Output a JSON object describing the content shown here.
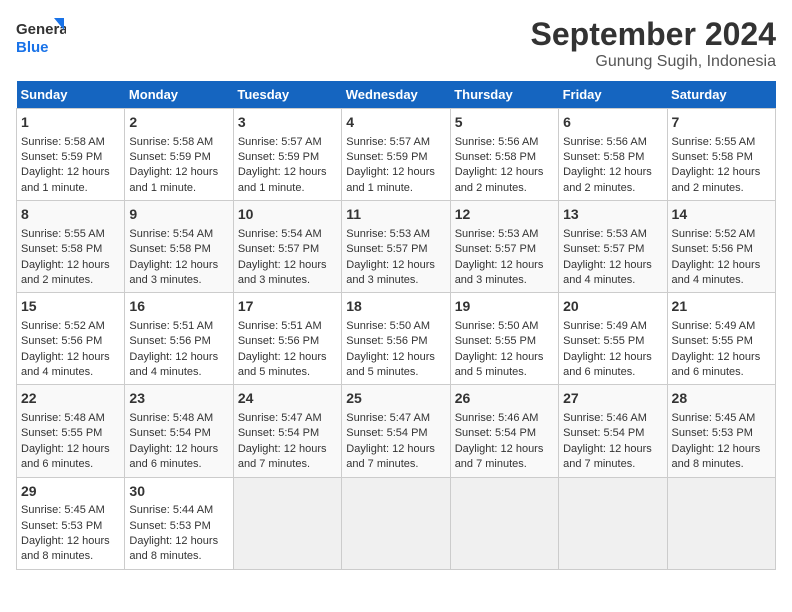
{
  "header": {
    "logo_line1": "General",
    "logo_line2": "Blue",
    "title": "September 2024",
    "subtitle": "Gunung Sugih, Indonesia"
  },
  "days_of_week": [
    "Sunday",
    "Monday",
    "Tuesday",
    "Wednesday",
    "Thursday",
    "Friday",
    "Saturday"
  ],
  "weeks": [
    [
      {
        "day": "1",
        "info": "Sunrise: 5:58 AM\nSunset: 5:59 PM\nDaylight: 12 hours and 1 minute."
      },
      {
        "day": "2",
        "info": "Sunrise: 5:58 AM\nSunset: 5:59 PM\nDaylight: 12 hours and 1 minute."
      },
      {
        "day": "3",
        "info": "Sunrise: 5:57 AM\nSunset: 5:59 PM\nDaylight: 12 hours and 1 minute."
      },
      {
        "day": "4",
        "info": "Sunrise: 5:57 AM\nSunset: 5:59 PM\nDaylight: 12 hours and 1 minute."
      },
      {
        "day": "5",
        "info": "Sunrise: 5:56 AM\nSunset: 5:58 PM\nDaylight: 12 hours and 2 minutes."
      },
      {
        "day": "6",
        "info": "Sunrise: 5:56 AM\nSunset: 5:58 PM\nDaylight: 12 hours and 2 minutes."
      },
      {
        "day": "7",
        "info": "Sunrise: 5:55 AM\nSunset: 5:58 PM\nDaylight: 12 hours and 2 minutes."
      }
    ],
    [
      {
        "day": "8",
        "info": "Sunrise: 5:55 AM\nSunset: 5:58 PM\nDaylight: 12 hours and 2 minutes."
      },
      {
        "day": "9",
        "info": "Sunrise: 5:54 AM\nSunset: 5:58 PM\nDaylight: 12 hours and 3 minutes."
      },
      {
        "day": "10",
        "info": "Sunrise: 5:54 AM\nSunset: 5:57 PM\nDaylight: 12 hours and 3 minutes."
      },
      {
        "day": "11",
        "info": "Sunrise: 5:53 AM\nSunset: 5:57 PM\nDaylight: 12 hours and 3 minutes."
      },
      {
        "day": "12",
        "info": "Sunrise: 5:53 AM\nSunset: 5:57 PM\nDaylight: 12 hours and 3 minutes."
      },
      {
        "day": "13",
        "info": "Sunrise: 5:53 AM\nSunset: 5:57 PM\nDaylight: 12 hours and 4 minutes."
      },
      {
        "day": "14",
        "info": "Sunrise: 5:52 AM\nSunset: 5:56 PM\nDaylight: 12 hours and 4 minutes."
      }
    ],
    [
      {
        "day": "15",
        "info": "Sunrise: 5:52 AM\nSunset: 5:56 PM\nDaylight: 12 hours and 4 minutes."
      },
      {
        "day": "16",
        "info": "Sunrise: 5:51 AM\nSunset: 5:56 PM\nDaylight: 12 hours and 4 minutes."
      },
      {
        "day": "17",
        "info": "Sunrise: 5:51 AM\nSunset: 5:56 PM\nDaylight: 12 hours and 5 minutes."
      },
      {
        "day": "18",
        "info": "Sunrise: 5:50 AM\nSunset: 5:56 PM\nDaylight: 12 hours and 5 minutes."
      },
      {
        "day": "19",
        "info": "Sunrise: 5:50 AM\nSunset: 5:55 PM\nDaylight: 12 hours and 5 minutes."
      },
      {
        "day": "20",
        "info": "Sunrise: 5:49 AM\nSunset: 5:55 PM\nDaylight: 12 hours and 6 minutes."
      },
      {
        "day": "21",
        "info": "Sunrise: 5:49 AM\nSunset: 5:55 PM\nDaylight: 12 hours and 6 minutes."
      }
    ],
    [
      {
        "day": "22",
        "info": "Sunrise: 5:48 AM\nSunset: 5:55 PM\nDaylight: 12 hours and 6 minutes."
      },
      {
        "day": "23",
        "info": "Sunrise: 5:48 AM\nSunset: 5:54 PM\nDaylight: 12 hours and 6 minutes."
      },
      {
        "day": "24",
        "info": "Sunrise: 5:47 AM\nSunset: 5:54 PM\nDaylight: 12 hours and 7 minutes."
      },
      {
        "day": "25",
        "info": "Sunrise: 5:47 AM\nSunset: 5:54 PM\nDaylight: 12 hours and 7 minutes."
      },
      {
        "day": "26",
        "info": "Sunrise: 5:46 AM\nSunset: 5:54 PM\nDaylight: 12 hours and 7 minutes."
      },
      {
        "day": "27",
        "info": "Sunrise: 5:46 AM\nSunset: 5:54 PM\nDaylight: 12 hours and 7 minutes."
      },
      {
        "day": "28",
        "info": "Sunrise: 5:45 AM\nSunset: 5:53 PM\nDaylight: 12 hours and 8 minutes."
      }
    ],
    [
      {
        "day": "29",
        "info": "Sunrise: 5:45 AM\nSunset: 5:53 PM\nDaylight: 12 hours and 8 minutes."
      },
      {
        "day": "30",
        "info": "Sunrise: 5:44 AM\nSunset: 5:53 PM\nDaylight: 12 hours and 8 minutes."
      },
      {
        "day": "",
        "info": ""
      },
      {
        "day": "",
        "info": ""
      },
      {
        "day": "",
        "info": ""
      },
      {
        "day": "",
        "info": ""
      },
      {
        "day": "",
        "info": ""
      }
    ]
  ]
}
